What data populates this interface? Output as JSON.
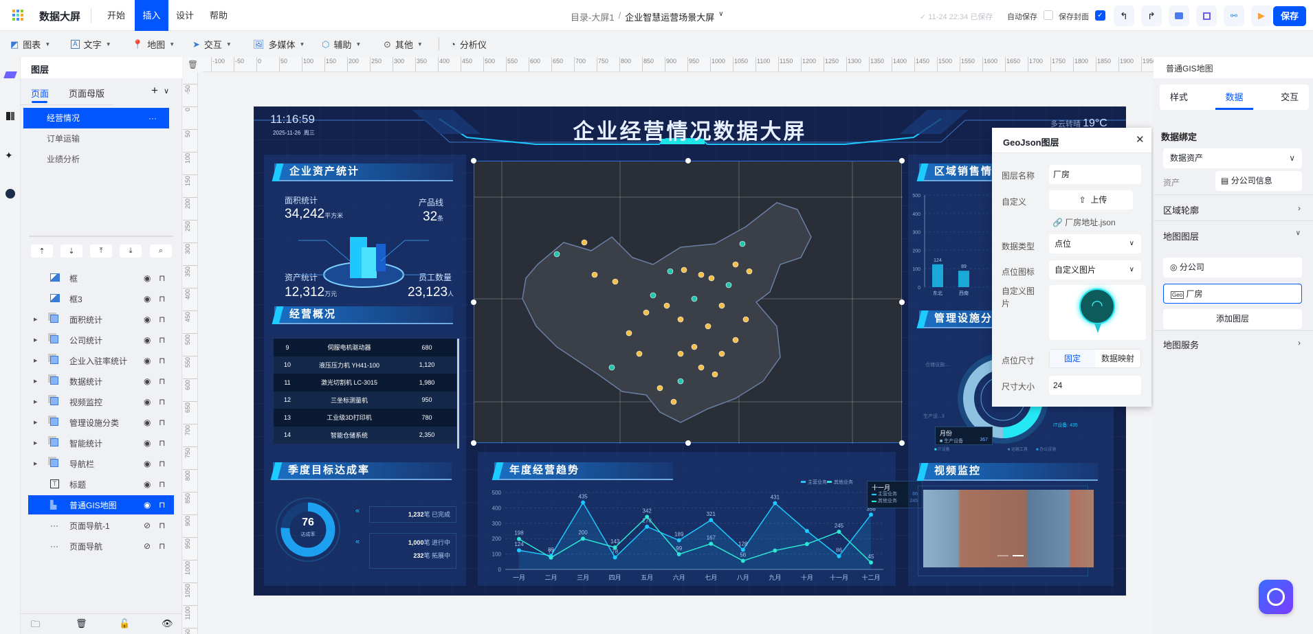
{
  "app": {
    "title": "数据大屏",
    "menus": [
      "开始",
      "插入",
      "设计",
      "帮助"
    ],
    "active_menu": "插入"
  },
  "breadcrumb": {
    "root": "目录-大屏1",
    "separator": "/",
    "current": "企业智慧运营场景大屏"
  },
  "status": {
    "saved": "11-24 22:34 已保存",
    "auto_save": "自动保存",
    "auto_save_checked": false,
    "save_cover": "保存封面",
    "save_cover_checked": true,
    "save_button": "保存"
  },
  "toolbar": {
    "items": [
      "图表",
      "文字",
      "地图",
      "交互",
      "多媒体",
      "辅助",
      "其他",
      "分析仪"
    ]
  },
  "left": {
    "title": "图层",
    "tabs": [
      "页面",
      "页面母版"
    ],
    "active_tab": "页面",
    "pages": [
      "经营情况",
      "订单运输",
      "业绩分析"
    ],
    "selected_page": "经营情况",
    "more": "···",
    "layers": [
      {
        "name": "框",
        "icon": "image-icon",
        "group": false,
        "visible": true
      },
      {
        "name": "框3",
        "icon": "image-icon",
        "group": false,
        "visible": true
      },
      {
        "name": "面积统计",
        "icon": "group-icon",
        "group": true,
        "visible": true
      },
      {
        "name": "公司统计",
        "icon": "group-icon",
        "group": true,
        "visible": true
      },
      {
        "name": "企业入驻率统计",
        "icon": "group-icon",
        "group": true,
        "visible": true
      },
      {
        "name": "数据统计",
        "icon": "group-icon",
        "group": true,
        "visible": true
      },
      {
        "name": "视频监控",
        "icon": "group-icon",
        "group": true,
        "visible": true
      },
      {
        "name": "管理设施分类",
        "icon": "group-icon",
        "group": true,
        "visible": true
      },
      {
        "name": "智能统计",
        "icon": "group-icon",
        "group": true,
        "visible": true
      },
      {
        "name": "导航栏",
        "icon": "group-icon",
        "group": true,
        "visible": true
      },
      {
        "name": "标题",
        "icon": "text-icon",
        "group": false,
        "visible": true
      },
      {
        "name": "普通GIS地图",
        "icon": "map-icon",
        "group": false,
        "visible": true,
        "selected": true
      },
      {
        "name": "页面导航-1",
        "icon": "more-icon",
        "group": false,
        "visible": false
      },
      {
        "name": "页面导航",
        "icon": "more-icon",
        "group": false,
        "visible": false
      }
    ]
  },
  "ruler": {
    "h_start": -100,
    "h_end": 1950,
    "step": 50,
    "v_start": -50,
    "v_end": 1150
  },
  "screen": {
    "title": "企业经营情况数据大屏",
    "time": "11:16:59",
    "date": "2025-11-26",
    "weekday": "周三",
    "weather": "多云转晴",
    "temperature": "19°C",
    "assets": {
      "title": "企业资产统计",
      "area_label": "面积统计",
      "area_value": "34,242",
      "area_unit": "平方米",
      "lines_label": "产品线",
      "lines_value": "32",
      "lines_unit": "条",
      "asset_label": "资产统计",
      "asset_value": "12,312",
      "asset_unit": "万元",
      "staff_label": "员工数量",
      "staff_value": "23,123",
      "staff_unit": "人"
    },
    "overview": {
      "title": "经营概况",
      "rows": [
        [
          "9",
          "伺服电机驱动器",
          "680"
        ],
        [
          "10",
          "液压压力机 YH41-100",
          "1,120"
        ],
        [
          "11",
          "激光切割机 LC-3015",
          "1,980"
        ],
        [
          "12",
          "三坐标测量机",
          "950"
        ],
        [
          "13",
          "工业级3D打印机",
          "780"
        ],
        [
          "14",
          "智能仓储系统",
          "2,350"
        ]
      ]
    },
    "quarter": {
      "title": "季度目标达成率",
      "rate": "76",
      "rate_label": "达成率",
      "rate_value": 76,
      "done": "1,232",
      "done_unit": "笔",
      "done_label": "已完成",
      "doing": "1,000",
      "doing_unit": "笔",
      "doing_label": "进行中",
      "expand": "232",
      "expand_unit": "笔",
      "expand_label": "拓展中"
    },
    "trend": {
      "title": "年度经营趋势"
    },
    "region": {
      "title": "区域销售情况"
    },
    "facility": {
      "title": "管理设施分类",
      "label_storage": "仓储设施:...",
      "label_production": "生产设...3",
      "label_it": "IT设备: 435",
      "tooltip_title": "月份",
      "tooltip_series": "生产设备",
      "tooltip_value": "367",
      "legend": [
        "IT设备",
        "生产设备",
        "运输工具",
        "办公设施"
      ]
    },
    "video": {
      "title": "视频监控"
    }
  },
  "dialog": {
    "title": "GeoJson图层",
    "layer_name_label": "图层名称",
    "layer_name": "厂房",
    "custom_label": "自定义",
    "upload": "上传",
    "file": "厂房地址.json",
    "data_type_label": "数据类型",
    "data_type": "点位",
    "point_icon_label": "点位图标",
    "point_icon": "自定义图片",
    "custom_image_label": "自定义图片",
    "point_size_label": "点位尺寸",
    "size_modes": [
      "固定",
      "数据映射"
    ],
    "size_mode": "固定",
    "size_label": "尺寸大小",
    "size": "24"
  },
  "right": {
    "title": "普通GIS地图",
    "tabs": [
      "样式",
      "数据",
      "交互"
    ],
    "active_tab": "数据",
    "binding": "数据绑定",
    "binding_source": "数据资产",
    "asset_label": "资产",
    "asset": "分公司信息",
    "region_outline": "区域轮廓",
    "map_layers": "地图图层",
    "layers": [
      "分公司",
      "厂房"
    ],
    "selected_layer": "厂房",
    "add_layer": "添加图层",
    "map_service": "地图服务"
  },
  "colors": {
    "accent": "#0256ff",
    "screen_bg": "#13214d",
    "main_series": "#1ec8ff",
    "other_series": "#2ee6d6"
  },
  "chart_data": [
    {
      "type": "line",
      "title": "年度经营趋势",
      "categories": [
        "一月",
        "二月",
        "三月",
        "四月",
        "五月",
        "六月",
        "七月",
        "八月",
        "九月",
        "十月",
        "十一月",
        "十二月"
      ],
      "series": [
        {
          "name": "主营业务",
          "values": [
            124,
            89,
            435,
            78,
            278,
            189,
            321,
            128,
            431,
            250,
            86,
            356
          ]
        },
        {
          "name": "其他业务",
          "values": [
            198,
            77,
            200,
            143,
            342,
            99,
            167,
            56,
            123,
            165,
            245,
            45
          ]
        }
      ],
      "ylim": [
        0,
        500
      ],
      "yticks": [
        0,
        100,
        200,
        300,
        400,
        500
      ],
      "legend": "top-right",
      "tooltip": {
        "category": "十一月",
        "rows": [
          [
            "主营业务",
            "86"
          ],
          [
            "其他业务",
            "245"
          ]
        ]
      }
    },
    {
      "type": "bar",
      "title": "区域销售情况",
      "categories": [
        "东北",
        "西南"
      ],
      "values": [
        124,
        89
      ],
      "ylim": [
        0,
        500
      ],
      "yticks": [
        0,
        100,
        200,
        300,
        400,
        500
      ]
    }
  ]
}
